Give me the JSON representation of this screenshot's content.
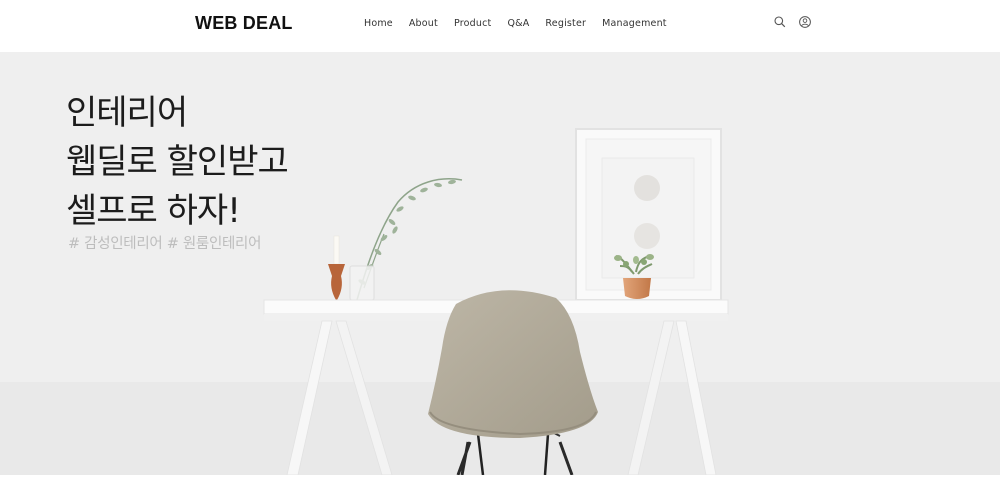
{
  "header": {
    "logo": "WEB DEAL",
    "nav": [
      {
        "label": "Home"
      },
      {
        "label": "About"
      },
      {
        "label": "Product"
      },
      {
        "label": "Q&A"
      },
      {
        "label": "Register"
      },
      {
        "label": "Management"
      }
    ],
    "icons": [
      "search-icon",
      "user-icon"
    ]
  },
  "hero": {
    "headline_line1": "인테리어",
    "headline_line2": "웹딜로 할인받고",
    "headline_line3": "셀프로 하자!",
    "hashtags": "# 감성인테리어 # 원룸인테리어"
  },
  "colors": {
    "text": "#1c1c1c",
    "hashtag": "#bdbdbd",
    "chair": "#b3ac9c",
    "vase": "#d08a5a"
  }
}
